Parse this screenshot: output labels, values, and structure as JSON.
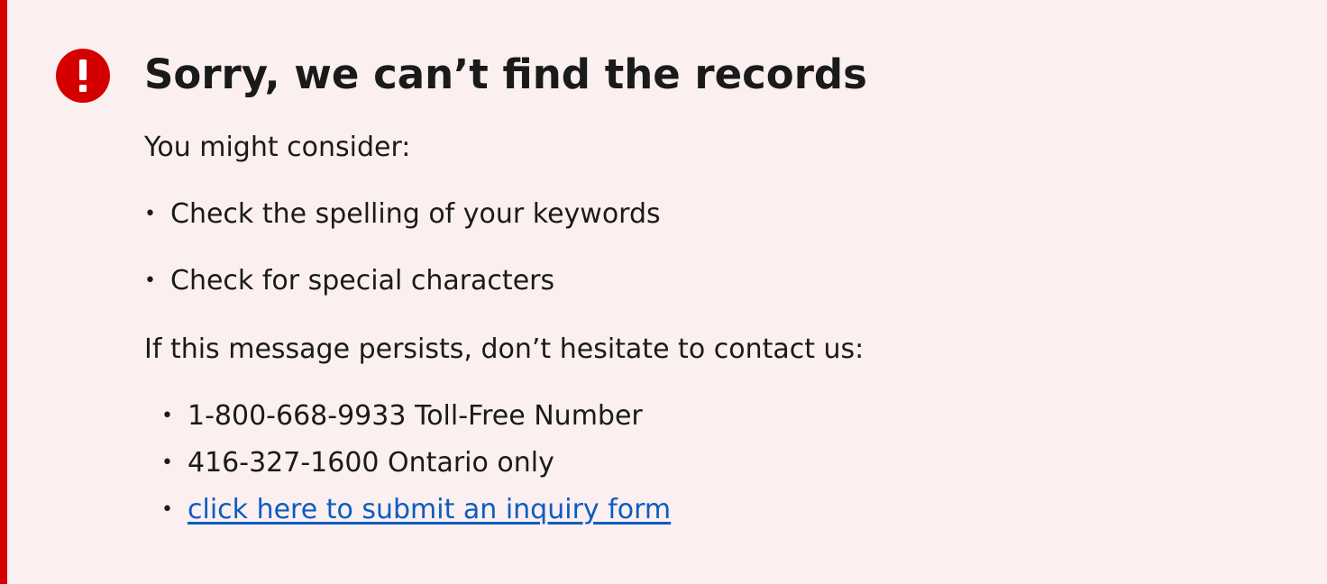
{
  "alert": {
    "icon": "exclamation-circle-icon",
    "title": "Sorry, we can’t find the records",
    "intro": "You might consider:",
    "suggestions": [
      "Check the spelling of your keywords",
      "Check for special characters"
    ],
    "contact_intro": "If this message persists, don’t hesitate to contact us:",
    "contacts": [
      "1-800-668-9933 Toll-Free Number",
      "416-327-1600 Ontario only"
    ],
    "inquiry_link": "click here to submit an inquiry form"
  },
  "colors": {
    "accent_red": "#D40000",
    "background": "#FBEFEF",
    "text": "#1A1A1A",
    "link": "#0B5CC2"
  }
}
